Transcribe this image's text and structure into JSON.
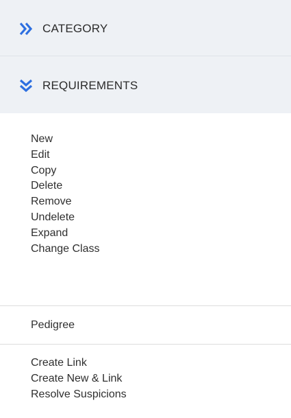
{
  "sections": {
    "category": {
      "label": "CATEGORY",
      "icon": "chevron-double-right-icon",
      "expanded": false
    },
    "requirements": {
      "label": "REQUIREMENTS",
      "icon": "chevron-double-down-icon",
      "expanded": true
    }
  },
  "menu": {
    "group1": [
      "New",
      "Edit",
      "Copy",
      "Delete",
      "Remove",
      "Undelete",
      "Expand",
      "Change Class"
    ],
    "group2": [
      "Pedigree"
    ],
    "group3": [
      "Create Link",
      "Create New & Link",
      "Resolve Suspicions"
    ]
  },
  "colors": {
    "accent": "#2d6fe0",
    "header_bg": "#eef1f5",
    "text": "#2f2f2f"
  }
}
